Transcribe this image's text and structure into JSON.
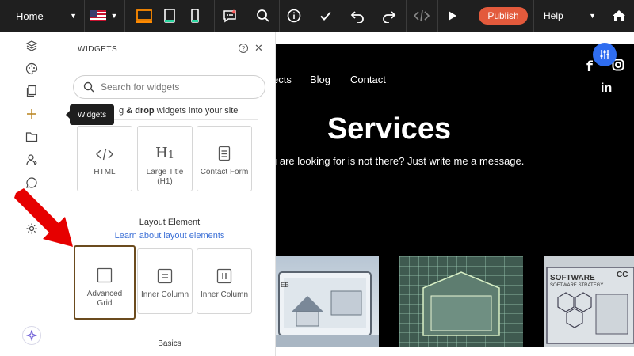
{
  "topbar": {
    "page_label": "Home",
    "publish_label": "Publish",
    "help_label": "Help"
  },
  "tooltip": {
    "label": "Widgets"
  },
  "panel": {
    "title": "WIDGETS",
    "search_placeholder": "Search for widgets",
    "drag_prefix": "g ",
    "drag_bold": "& drop",
    "drag_suffix": " widgets into your site",
    "widgets": [
      {
        "label": "HTML"
      },
      {
        "label": "Large Title (H1)"
      },
      {
        "label": "Contact Form"
      }
    ],
    "layout_section_title": "Layout Element",
    "layout_link": "Learn about layout elements",
    "layout_items": [
      {
        "label": "Advanced Grid"
      },
      {
        "label": "Inner Column"
      },
      {
        "label": "Inner Column"
      }
    ],
    "next_section_title": "Basics"
  },
  "site": {
    "nav": [
      {
        "label": "ects"
      },
      {
        "label": "Blog"
      },
      {
        "label": "Contact"
      }
    ],
    "hero_title": "Services",
    "hero_subtitle": "u are looking for is not there? Just write me a message.",
    "thumb_1_text": "EB",
    "thumb_3_title": "SOFTWARE",
    "thumb_3_subtitle": "SOFTWARE STRATEGY",
    "thumb_3_corner": "CC"
  },
  "colors": {
    "topbar_bg": "#1f1f1f",
    "publish": "#e35a3c",
    "link": "#3b6fd6",
    "highlight": "#6b4b1e",
    "arrow": "#e60000",
    "fab": "#2f6df0",
    "device_active": "#ff8a00",
    "device_mobile": "#2bd6a0"
  },
  "icons": [
    "chevron-down-icon",
    "flag-us-icon",
    "desktop-icon",
    "tablet-icon",
    "mobile-icon",
    "ai-chat-icon",
    "search-icon",
    "info-icon",
    "check-icon",
    "undo-icon",
    "redo-icon",
    "code-icon",
    "play-icon",
    "home-icon",
    "layers-icon",
    "palette-icon",
    "pages-icon",
    "add-icon",
    "folder-icon",
    "user-icon",
    "chat-icon",
    "settings-icon",
    "sparkle-icon",
    "close-icon",
    "help-icon",
    "grid-icon",
    "column-icon",
    "facebook-icon",
    "instagram-icon",
    "linkedin-icon",
    "sliders-icon"
  ]
}
